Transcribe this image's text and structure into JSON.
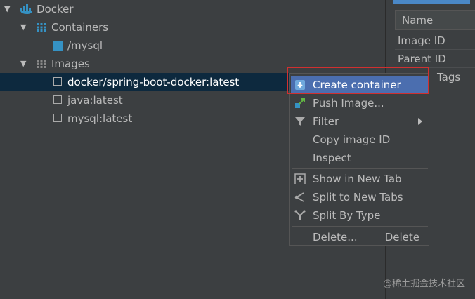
{
  "tree": {
    "root_label": "Docker",
    "containers_label": "Containers",
    "container_items": [
      "/mysql"
    ],
    "images_label": "Images",
    "image_items": [
      "docker/spring-boot-docker:latest",
      "java:latest",
      "mysql:latest"
    ]
  },
  "properties": {
    "header": "Name",
    "rows": [
      "Image ID",
      "Parent ID",
      "Tags"
    ]
  },
  "menu": {
    "items": [
      {
        "label": "Create container",
        "icon": "create-container-icon",
        "highlight": true
      },
      {
        "label": "Push Image...",
        "icon": "push-icon"
      },
      {
        "label": "Filter",
        "icon": "filter-icon",
        "submenu": true
      },
      {
        "label": "Copy image ID"
      },
      {
        "label": "Inspect"
      },
      {
        "label": "Show in New Tab",
        "icon": "new-tab-icon"
      },
      {
        "label": "Split to New Tabs",
        "icon": "split-tabs-icon"
      },
      {
        "label": "Split By Type",
        "icon": "split-type-icon"
      },
      {
        "label": "Delete...",
        "shortcut": "Delete"
      }
    ]
  },
  "colors": {
    "background": "#3c3f41",
    "selection": "#0d293e",
    "menu_highlight": "#4b6eaf",
    "annotation": "#d03030",
    "docker_blue": "#3592c4"
  },
  "watermark": "@稀土掘金技术社区"
}
